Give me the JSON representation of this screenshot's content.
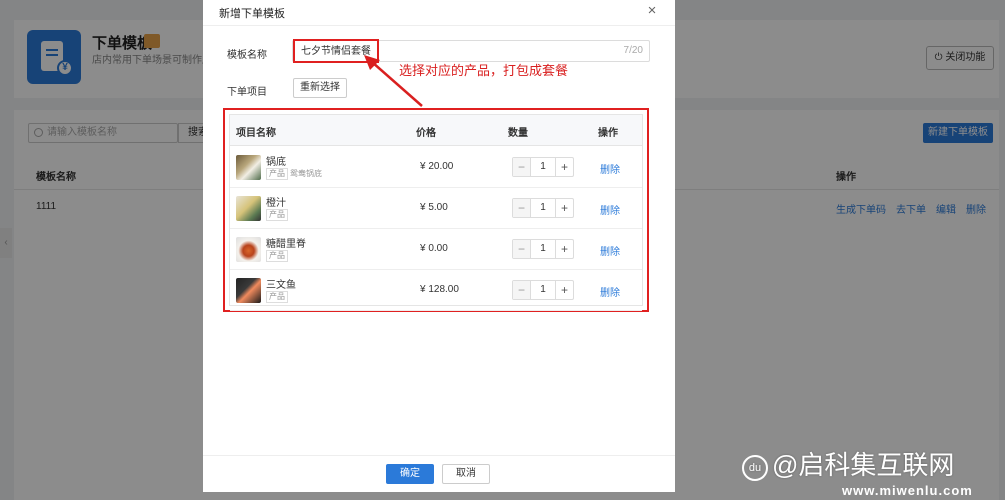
{
  "background_page": {
    "title": "下单模板",
    "subtitle": "店内常用下单场景可制作成模板",
    "close_button": "关闭功能",
    "search_placeholder": "请输入模板名称",
    "search_button": "搜索",
    "new_button": "新建下单模板",
    "columns": {
      "name": "模板名称",
      "ops": "操作"
    },
    "row": {
      "name": "1111",
      "ops": [
        "生成下单码",
        "去下单",
        "编辑",
        "删除"
      ]
    },
    "side_arrow": "‹"
  },
  "modal": {
    "title": "新增下单模板",
    "close_glyph": "×",
    "name_label": "模板名称",
    "name_value": "七夕节情侣套餐",
    "name_count": "7/20",
    "items_label": "下单项目",
    "reselect_button": "重新选择",
    "annotation": "选择对应的产品，打包成套餐",
    "columns": {
      "name": "项目名称",
      "price": "价格",
      "qty": "数量",
      "op": "操作"
    },
    "items": [
      {
        "name": "锅底",
        "tag": "产品",
        "desc": "鸳鸯锅底",
        "price": "¥ 20.00",
        "qty": "1",
        "delete": "删除"
      },
      {
        "name": "橙汁",
        "tag": "产品",
        "desc": "",
        "price": "¥ 5.00",
        "qty": "1",
        "delete": "删除"
      },
      {
        "name": "糖醋里脊",
        "tag": "产品",
        "desc": "",
        "price": "¥ 0.00",
        "qty": "1",
        "delete": "删除"
      },
      {
        "name": "三文鱼",
        "tag": "产品",
        "desc": "",
        "price": "¥ 128.00",
        "qty": "1",
        "delete": "删除"
      }
    ],
    "stepper_minus": "−",
    "stepper_plus": "+",
    "ok_button": "确定",
    "cancel_button": "取消"
  },
  "watermark": {
    "badge": "du",
    "text": "@启科集互联网",
    "url": "www.miwenlu.com"
  },
  "colors": {
    "primary": "#2b7ad9",
    "annotation_red": "#e02020"
  }
}
